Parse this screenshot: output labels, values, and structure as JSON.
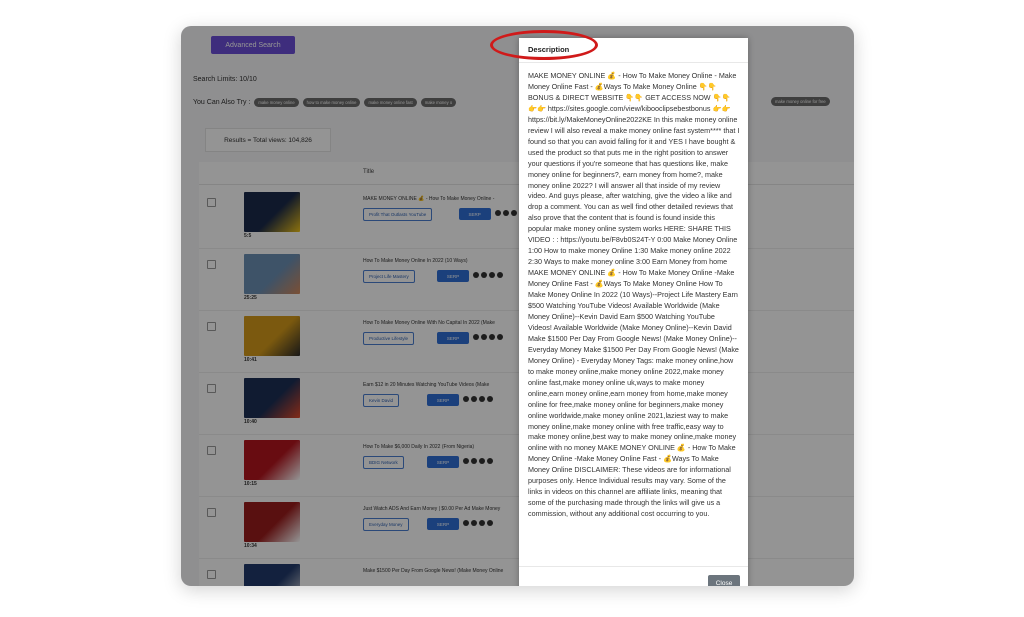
{
  "toolbar": {
    "advanced_search_label": "Advanced Search"
  },
  "search_limits": "Search Limits: 10/10",
  "also_try": {
    "label": "You Can Also Try :",
    "chips": [
      "make money online",
      "how to make money online",
      "make money online fast",
      "make money o"
    ],
    "chips_right": [
      "make money online for free"
    ]
  },
  "results_summary": "Results = Total views: 104,826",
  "table": {
    "title_header": "Title",
    "rows": [
      {
        "title": "MAKE MONEY ONLINE 💰 - How To Make Money Online -",
        "channel": "Profit That Outlasts YouTube",
        "duration": "5:5",
        "serp": "SERP",
        "thumb_color": "#1b2a4a",
        "thumb_accent": "#f0c419"
      },
      {
        "title": "How To Make Money Online In 2022 (10 Ways)",
        "channel": "Project Life Mastery",
        "duration": "25:25",
        "serp": "SERP",
        "thumb_color": "#6b8fb3",
        "thumb_accent": "#d38a5c"
      },
      {
        "title": "How To Make Money Online With No Capital In 2022 (Make",
        "channel": "Productive Lifestyle",
        "duration": "10:41",
        "serp": "SERP",
        "thumb_color": "#d49a1a",
        "thumb_accent": "#2a2a2a"
      },
      {
        "title": "Earn $12 in 20 Minutes Watching YouTube Videos (Make",
        "channel": "Kevin David",
        "duration": "10:40",
        "serp": "SERP",
        "thumb_color": "#1c2f55",
        "thumb_accent": "#e24a2a"
      },
      {
        "title": "How To Make $6,000 Daily In 2022 (From Nigeria)",
        "channel": "BDIG Network",
        "duration": "10:15",
        "serp": "SERP",
        "thumb_color": "#b4151e",
        "thumb_accent": "#ffffff"
      },
      {
        "title": "Just Watch ADS And Earn Money | $0.00 Per Ad Make Money",
        "channel": "Everyday Money",
        "duration": "10:34",
        "serp": "SERP",
        "thumb_color": "#9a1c1c",
        "thumb_accent": "#ffffff"
      },
      {
        "title": "Make $1500 Per Day From Google News! (Make Money Online",
        "channel": "",
        "duration": "",
        "serp": "",
        "thumb_color": "#223a6b",
        "thumb_accent": "#e0e0e0"
      }
    ]
  },
  "modal": {
    "title": "Description",
    "body": "MAKE MONEY ONLINE 💰 - How To Make Money Online - Make Money Online Fast - 💰Ways To Make Money Online 👇👇BONUS & DIRECT WEBSITE 👇👇 GET ACCESS NOW 👇👇 👉👉 https://sites.google.com/view/kibooclipsebestbonus 👉👉 https://bit.ly/MakeMoneyOnline2022KE In this make money online review I will also reveal a make money online fast system**** that I found so that you can avoid falling for it and YES I have bought & used the product so that puts me in the right position to answer your questions if you're someone that has questions like, make money online for beginners?, earn money from home?, make money online 2022? I will answer all that inside of my review video. And guys please, after watching, give the video a like and drop a comment. You can as well find other detailed reviews that also prove that the content that is found is found inside this popular make money online system works HERE: SHARE THIS VIDEO : : https://youtu.be/F8vb0S24T-Y 0:00 Make Money Online 1:00 How to make money Online 1:30 Make money online 2022 2:30 Ways to make money online 3:00 Earn Money from home MAKE MONEY ONLINE 💰 - How To Make Money Online -Make Money Online Fast - 💰Ways To Make Money Online How To Make Money Online In 2022 (10 Ways)--Project Life Mastery Earn $500 Watching YouTube Videos! Available Worldwide (Make Money Online)--Kevin David Earn $500 Watching YouTube Videos! Available Worldwide (Make Money Online)--Kevin David Make $1500 Per Day From Google News! (Make Money Online)--Everyday Money Make $1500 Per Day From Google News! (Make Money Online) - Everyday Money Tags: make money online,how to make money online,make money online 2022,make money online fast,make money online uk,ways to make money online,earn money online,earn money from home,make money online for free,make money online for beginners,make money online worldwide,make money online 2021,laziest way to make money online,make money online with free traffic,easy way to make money online,best way to make money online,make money online with no money MAKE MONEY ONLINE 💰 - How To Make Money Online -Make Money Online Fast - 💰Ways To Make Money Online DISCLAIMER: These videos are for informational purposes only. Hence Individual results may vary. Some of the links in videos on this channel are affiliate links, meaning that some of the purchasing made through the links will give us a commission, without any additional cost occurring to you.",
    "close_label": "Close"
  },
  "colors": {
    "accent_purple": "#6b4fd8",
    "serp_blue": "#2f6fd6",
    "annotation_red": "#d01a1a"
  }
}
